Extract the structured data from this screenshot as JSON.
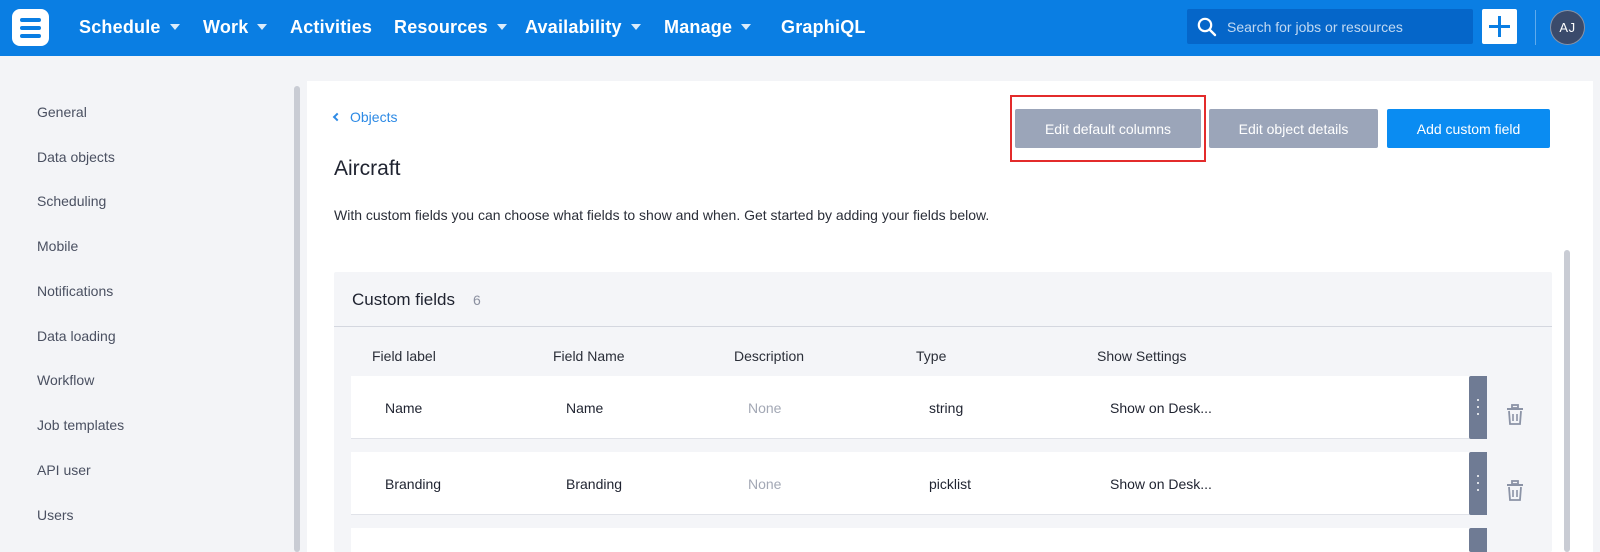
{
  "nav": {
    "items": [
      {
        "label": "Schedule",
        "dropdown": true
      },
      {
        "label": "Work",
        "dropdown": true
      },
      {
        "label": "Activities",
        "dropdown": false
      },
      {
        "label": "Resources",
        "dropdown": true
      },
      {
        "label": "Availability",
        "dropdown": true
      },
      {
        "label": "Manage",
        "dropdown": true
      },
      {
        "label": "GraphiQL",
        "dropdown": false
      }
    ],
    "search_placeholder": "Search for jobs or resources",
    "search_value": "",
    "avatar_initials": "AJ",
    "brand_color": "#0a7ee3"
  },
  "sidebar": {
    "items": [
      "General",
      "Data objects",
      "Scheduling",
      "Mobile",
      "Notifications",
      "Data loading",
      "Workflow",
      "Job templates",
      "API user",
      "Users"
    ]
  },
  "page": {
    "back_label": "Objects",
    "title": "Aircraft",
    "description": "With custom fields you can choose what fields to show and when. Get started by adding your fields below.",
    "buttons": {
      "edit_default_columns": "Edit default columns",
      "edit_object_details": "Edit object details",
      "add_custom_field": "Add custom field"
    }
  },
  "custom_fields": {
    "title": "Custom fields",
    "count": "6",
    "columns": [
      "Field label",
      "Field Name",
      "Description",
      "Type",
      "Show Settings"
    ],
    "rows": [
      {
        "label": "Name",
        "name": "Name",
        "description": "None",
        "type": "string",
        "show": "Show on Desk..."
      },
      {
        "label": "Branding",
        "name": "Branding",
        "description": "None",
        "type": "picklist",
        "show": "Show on Desk..."
      },
      {
        "label": "",
        "name": "",
        "description": "",
        "type": "",
        "show": ""
      }
    ]
  },
  "icons": {
    "search": "search-icon",
    "add": "plus-icon",
    "back": "chevron-left-icon",
    "row_menu": "kebab-menu-icon",
    "delete": "trash-icon"
  }
}
